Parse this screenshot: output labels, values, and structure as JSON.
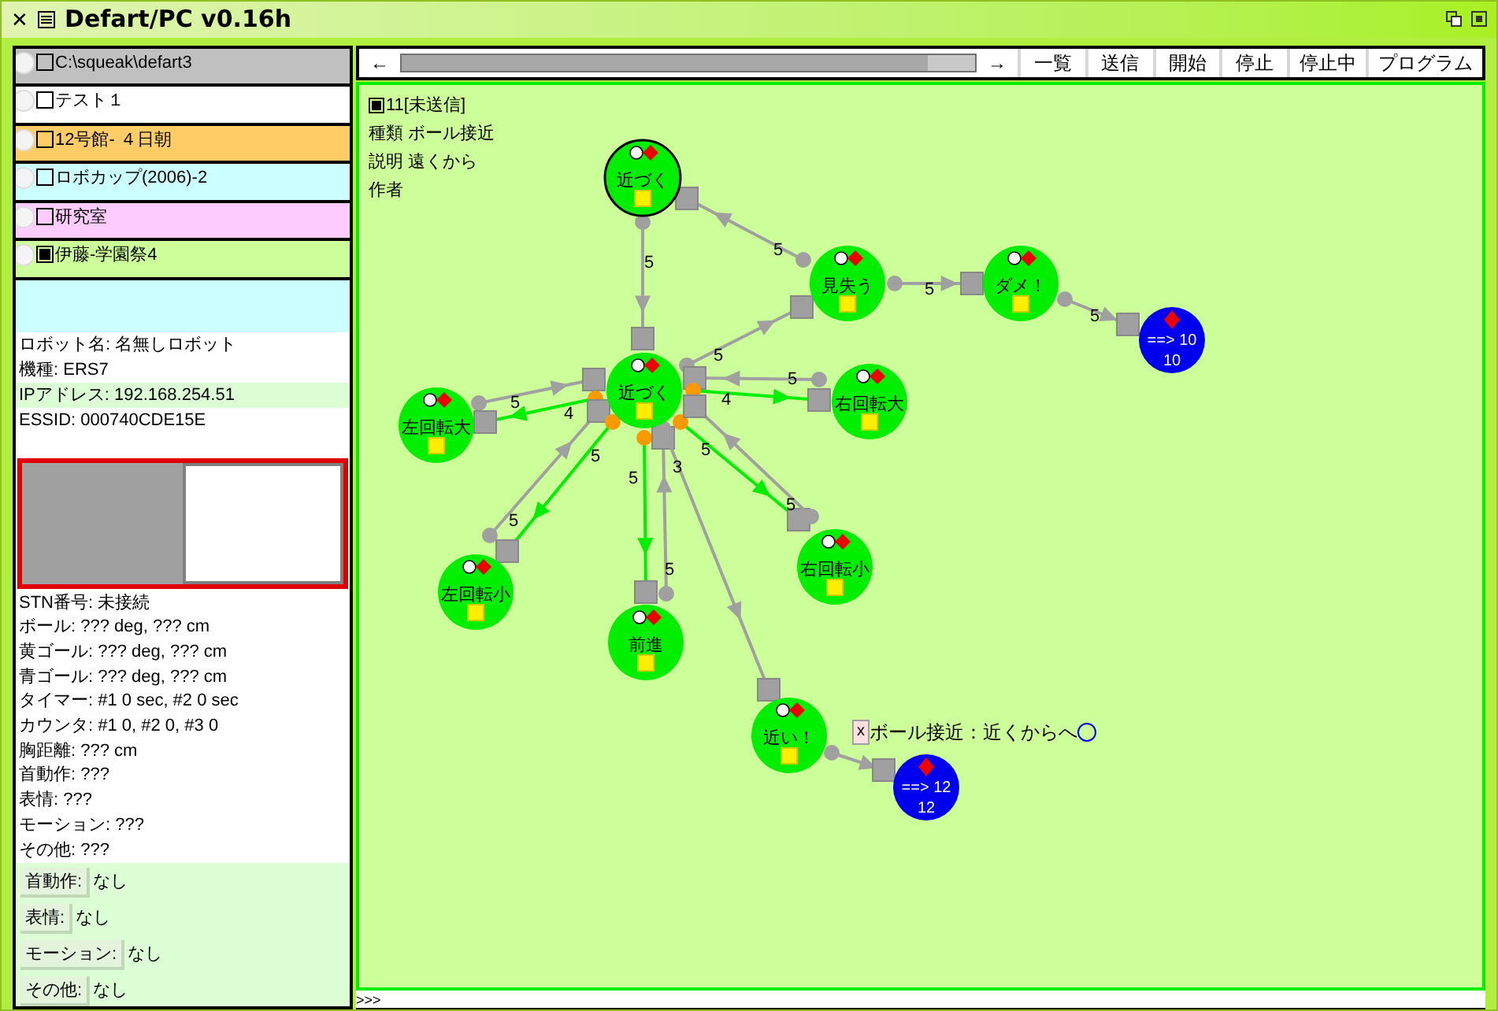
{
  "window": {
    "close": "✕",
    "title": "Defart/PC v0.16h"
  },
  "projects": [
    {
      "label": "C:\\squeak\\defart3",
      "checked": false,
      "color": "#c0c0c0"
    },
    {
      "label": "テスト１",
      "checked": false,
      "color": "#ffffff"
    },
    {
      "label": "12号館- ４日朝",
      "checked": false,
      "color": "#ffcc66"
    },
    {
      "label": "ロボカップ(2006)-2",
      "checked": false,
      "color": "#ccffff"
    },
    {
      "label": "研究室",
      "checked": false,
      "color": "#ffccff"
    },
    {
      "label": "伊藤-学園祭4",
      "checked": true,
      "color": "#ccff99"
    }
  ],
  "robot_info": [
    "ロボット名: 名無しロボット",
    "機種: ERS7",
    "IPアドレス: 192.168.254.51",
    "ESSID: 000740CDE15E"
  ],
  "status_lines": [
    "STN番号: 未接続",
    "ボール: ??? deg, ??? cm",
    "黄ゴール: ??? deg, ??? cm",
    "青ゴール: ??? deg, ??? cm",
    "タイマー: #1 0 sec, #2 0 sec",
    "カウンタ: #1 0, #2 0, #3 0",
    "胸距離: ??? cm",
    "首動作: ???",
    "表情: ???",
    "モーション: ???",
    "その他: ???"
  ],
  "commands": [
    {
      "label": "首動作:",
      "value": "なし"
    },
    {
      "label": "表情:",
      "value": "なし"
    },
    {
      "label": "モーション:",
      "value": "なし"
    },
    {
      "label": "その他:",
      "value": "なし"
    }
  ],
  "toolbar": {
    "back": "←",
    "forward": "→",
    "buttons": [
      "一覧",
      "送信",
      "開始",
      "停止",
      "停止中",
      "プログラム"
    ]
  },
  "program": {
    "checked": true,
    "title": "11[未送信]",
    "lines": [
      "種類 ボール接近",
      "説明 遠くから",
      "作者"
    ]
  },
  "nodes": [
    {
      "kind": "state",
      "label": "近づく",
      "selected": true
    },
    {
      "kind": "state",
      "label": "見失う",
      "selected": false
    },
    {
      "kind": "state",
      "label": "ダメ！",
      "selected": false
    },
    {
      "kind": "goal",
      "label": "==> 10",
      "sub": "10"
    },
    {
      "kind": "state",
      "label": "近づく",
      "selected": false
    },
    {
      "kind": "state",
      "label": "右回転大",
      "selected": false
    },
    {
      "kind": "state",
      "label": "左回転大",
      "selected": false
    },
    {
      "kind": "state",
      "label": "左回転小",
      "selected": false
    },
    {
      "kind": "state",
      "label": "右回転小",
      "selected": false
    },
    {
      "kind": "state",
      "label": "前進",
      "selected": false
    },
    {
      "kind": "state",
      "label": "近い！",
      "selected": false
    },
    {
      "kind": "goal",
      "label": "==> 12",
      "sub": "12"
    }
  ],
  "edges": [
    {
      "label": "5",
      "color": "#a0a0a0"
    },
    {
      "label": "5",
      "color": "#a0a0a0"
    },
    {
      "label": "5",
      "color": "#a0a0a0"
    },
    {
      "label": "5",
      "color": "#a0a0a0"
    },
    {
      "label": "5",
      "color": "#a0a0a0"
    },
    {
      "label": "5",
      "color": "#a0a0a0"
    },
    {
      "label": "4",
      "color": "#00ee00"
    },
    {
      "label": "5",
      "color": "#a0a0a0"
    },
    {
      "label": "4",
      "color": "#00ee00"
    },
    {
      "label": "5",
      "color": "#a0a0a0"
    },
    {
      "label": "5",
      "color": "#00ee00"
    },
    {
      "label": "5",
      "color": "#00ee00"
    },
    {
      "label": "5",
      "color": "#a0a0a0"
    },
    {
      "label": "3",
      "color": "#a0a0a0"
    },
    {
      "label": "5",
      "color": "#00ee00"
    },
    {
      "label": "5",
      "color": "#a0a0a0"
    },
    {
      "color": "#a0a0a0"
    }
  ],
  "tooltip": {
    "close": "x",
    "text": "ボール接近：近くからへ"
  },
  "console": {
    "prompt": ">>>"
  }
}
